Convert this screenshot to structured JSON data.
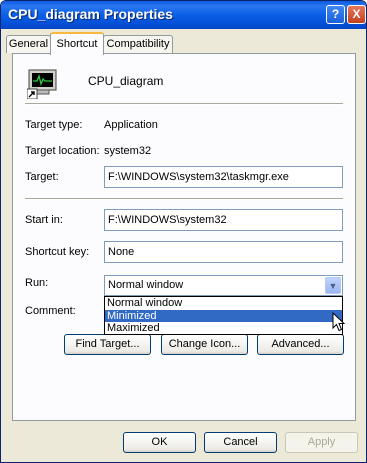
{
  "window": {
    "title": "CPU_diagram Properties"
  },
  "title_buttons": {
    "help": "?",
    "close": "X"
  },
  "tabs": [
    {
      "label": "General",
      "selected": false
    },
    {
      "label": "Shortcut",
      "selected": true
    },
    {
      "label": "Compatibility",
      "selected": false
    }
  ],
  "shortcut": {
    "name": "CPU_diagram",
    "target_type_label": "Target type:",
    "target_type_value": "Application",
    "target_location_label": "Target location:",
    "target_location_value": "system32",
    "target_label": "Target:",
    "target_value": "F:\\WINDOWS\\system32\\taskmgr.exe",
    "start_in_label": "Start in:",
    "start_in_value": "F:\\WINDOWS\\system32",
    "shortcut_key_label": "Shortcut key:",
    "shortcut_key_value": "None",
    "run_label": "Run:",
    "run_value": "Normal window",
    "run_options": [
      "Normal window",
      "Minimized",
      "Maximized"
    ],
    "highlighted_option": "Minimized",
    "comment_label": "Comment:",
    "find_target_label": "Find Target...",
    "change_icon_label": "Change Icon...",
    "advanced_label": "Advanced..."
  },
  "footer": {
    "ok_label": "OK",
    "cancel_label": "Cancel",
    "apply_label": "Apply"
  },
  "colors": {
    "titlebar": "#0a5fe6",
    "highlight": "#316ac5",
    "face": "#ece9d8"
  }
}
